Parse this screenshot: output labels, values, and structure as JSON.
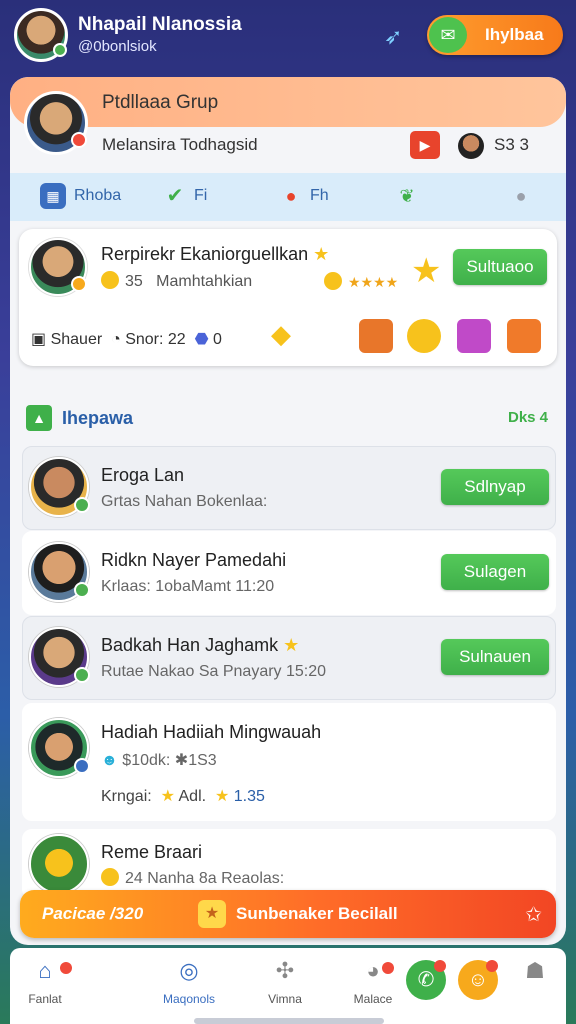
{
  "header": {
    "user_name": "Nhapail Nlanossia",
    "user_handle": "@0bonlsiok",
    "action_button": "Ihylbaa"
  },
  "group": {
    "title": "Ptdllaaa Grup",
    "subtitle": "Melansira Todhagsid",
    "member_count": "S3 3"
  },
  "filters": [
    {
      "label": "Rhoba"
    },
    {
      "label": "Fi"
    },
    {
      "label": "Fh"
    }
  ],
  "featured": {
    "title": "Rerpirekr Ekaniorguellkan",
    "coins": "35",
    "subtitle": "Mamhtahkian",
    "stars": "★★★★",
    "button": "Sultuaoo",
    "row2_label": "Shauer",
    "row2_score": "Snor: 22",
    "row2_count": "0"
  },
  "section": {
    "title": "Ihepawa",
    "right_label": "Dks 4"
  },
  "list": [
    {
      "title": "Eroga Lan",
      "sub": "Grtas   Nahan Bokenlaa:",
      "button": "Sdlnyap"
    },
    {
      "title": "Ridkn Nayer Pamedahi",
      "sub": "Krlaas:   1obaMamt   11:20",
      "button": "Sulagen"
    },
    {
      "title": "Badkah Han Jaghamk",
      "sub": "Rutae   Nakao Sa Pnayary  15:20",
      "button": "Sulnauen"
    },
    {
      "title": "Hadiah Hadiiah Mingwauah",
      "sub": "$10dk: ✱1S3",
      "sub2_label": "Krngai:",
      "sub2_a": "Adl.",
      "sub2_b": "1.35"
    },
    {
      "title": "Reme Braari",
      "sub": "24   Nanha 8a Reaolas:"
    }
  ],
  "promo": {
    "left": "Pacicae /320",
    "right": "Sunbenaker Becilall"
  },
  "nav": [
    {
      "label": "Fanlat"
    },
    {
      "label": "Maqonols"
    },
    {
      "label": "Vimna"
    },
    {
      "label": "Malace"
    }
  ],
  "colors": {
    "accent_green": "#3fb04a",
    "accent_orange": "#ff7a1a",
    "link_blue": "#2a5fa8"
  }
}
